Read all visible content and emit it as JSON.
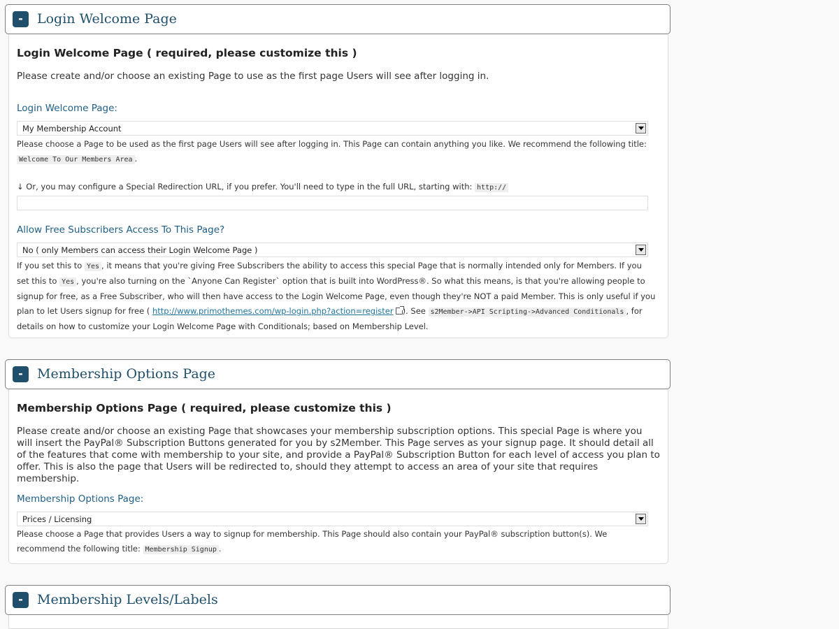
{
  "sections": {
    "login": {
      "header_title": "Login Welcome Page",
      "toggle": "-",
      "heading": "Login Welcome Page ( required, please customize this )",
      "intro": "Please create and/or choose an existing Page to use as the first page Users will see after logging in.",
      "field_label": "Login Welcome Page:",
      "select_value": "My Membership Account",
      "desc_pre": "Please choose a Page to be used as the first page Users will see after logging in. This Page can contain anything you like. We recommend the following title:",
      "desc_code": "Welcome To Our Members Area",
      "desc_post": ".",
      "redirect_pre": "↓ Or, you may configure a Special Redirection URL, if you prefer. You'll need to type in the full URL, starting with:",
      "redirect_code": "http://",
      "redirect_value": "",
      "free_label": "Allow Free Subscribers Access To This Page?",
      "free_select_value": "No ( only Members can access their Login Welcome Page )",
      "free_desc_1": "If you set this to",
      "free_desc_code1": "Yes",
      "free_desc_2": ", it means that you're giving Free Subscribers the ability to access this special Page that is normally intended only for Members. If you set this to",
      "free_desc_code2": "Yes",
      "free_desc_3": ", you're also turning on the `Anyone Can Register` option that is built into WordPress®. So what this means, is that you're allowing people to signup for free, as a Free Subscriber, who will then have access to the Login Welcome Page, even though they're NOT a paid Member. This is only useful if you plan to let Users signup for free (",
      "free_desc_link": "http://www.primothemes.com/wp-login.php?action=register",
      "free_desc_4": "). See",
      "free_desc_code3": "s2Member->API Scripting->Advanced Conditionals",
      "free_desc_5": ", for details on how to customize your Login Welcome Page with Conditionals; based on Membership Level."
    },
    "options": {
      "header_title": "Membership Options Page",
      "toggle": "-",
      "heading": "Membership Options Page ( required, please customize this )",
      "intro": "Please create and/or choose an existing Page that showcases your membership subscription options. This special Page is where you will insert the PayPal® Subscription Buttons generated for you by s2Member. This Page serves as your signup page. It should detail all of the features that come with membership to your site, and provide a PayPal® Subscription Button for each level of access you plan to offer. This is also the page that Users will be redirected to, should they attempt to access an area of your site that requires membership.",
      "field_label": "Membership Options Page:",
      "select_value": "Prices / Licensing",
      "desc_pre": "Please choose a Page that provides Users a way to signup for membership. This Page should also contain your PayPal® subscription button(s). We recommend the following title:",
      "desc_code": "Membership Signup",
      "desc_post": "."
    },
    "levels": {
      "header_title": "Membership Levels/Labels",
      "toggle": "-"
    }
  }
}
